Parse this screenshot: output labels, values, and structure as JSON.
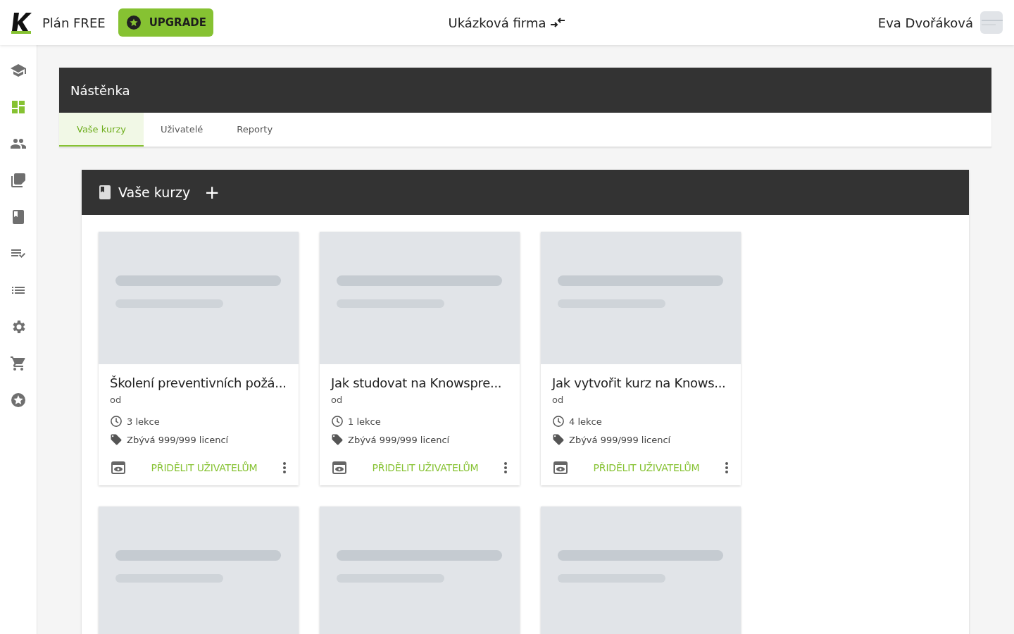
{
  "header": {
    "plan": "Plán FREE",
    "upgrade_button": "UPGRADE",
    "company": "Ukázková firma",
    "user": "Eva Dvořáková"
  },
  "sidebar": {
    "items": [
      {
        "selected": false
      },
      {
        "selected": true
      },
      {
        "selected": false
      },
      {
        "selected": false
      },
      {
        "selected": false
      },
      {
        "selected": false
      },
      {
        "selected": false
      },
      {
        "selected": false
      },
      {
        "selected": false
      },
      {
        "selected": false
      }
    ]
  },
  "page": {
    "title": "Nástěnka",
    "tabs": [
      {
        "label": "Vaše kurzy",
        "selected": true
      },
      {
        "label": "Uživatelé",
        "selected": false
      },
      {
        "label": "Reporty",
        "selected": false
      }
    ]
  },
  "courses_panel": {
    "title": "Vaše kurzy",
    "add_button": "+",
    "cards": [
      {
        "kind": "course",
        "title": "Školení preventivních požá...",
        "author": "od",
        "lessons": "3 lekce",
        "licenses": "Zbývá 999/999 licencí",
        "assign_button": "PŘIDĚLIT UŽIVATELŮM"
      },
      {
        "kind": "course",
        "title": "Jak studovat na Knowspre...",
        "author": "od",
        "lessons": "1 lekce",
        "licenses": "Zbývá 999/999 licencí",
        "assign_button": "PŘIDĚLIT UŽIVATELŮM"
      },
      {
        "kind": "course",
        "title": "Jak vytvořit kurz na Knows...",
        "author": "od",
        "lessons": "4 lekce",
        "licenses": "Zbývá 999/999 licencí",
        "assign_button": "PŘIDĚLIT UŽIVATELŮM"
      },
      {
        "kind": "picture"
      },
      {
        "kind": "picture"
      },
      {
        "kind": "picture"
      }
    ]
  }
}
